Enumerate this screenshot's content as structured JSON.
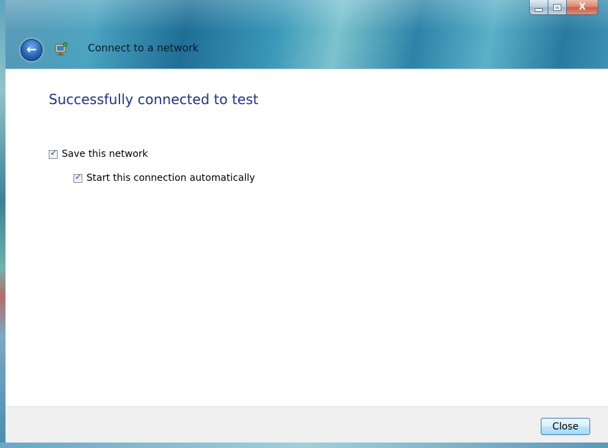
{
  "window": {
    "title": "Connect to a network",
    "caption_buttons": {
      "minimize_icon": "minimize-icon",
      "maximize_icon": "maximize-icon",
      "close_glyph": "X"
    },
    "back_icon": "back-arrow-icon",
    "app_icon": "network-connection-icon"
  },
  "main": {
    "heading": "Successfully connected to test",
    "options": [
      {
        "label": "Save this network",
        "checked": true
      },
      {
        "label": "Start this connection automatically",
        "checked": true
      }
    ]
  },
  "footer": {
    "close_label": "Close"
  },
  "colors": {
    "heading": "#1e3287",
    "accent": "#3c7fb1"
  }
}
